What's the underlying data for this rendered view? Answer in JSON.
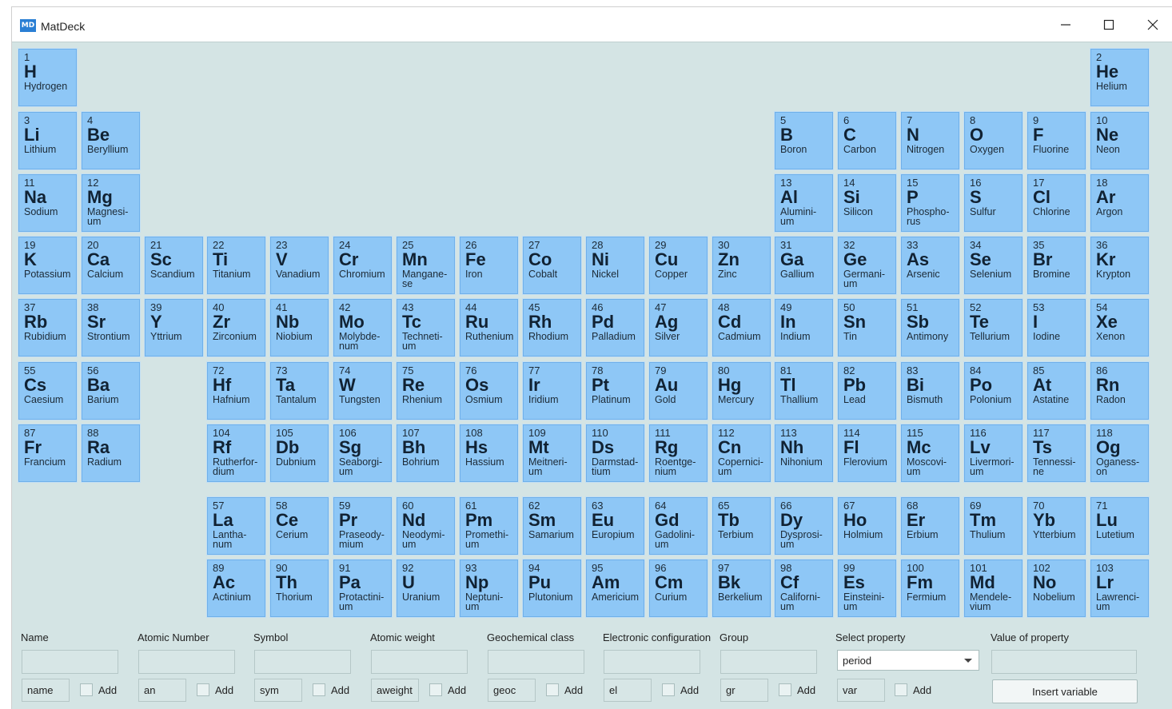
{
  "window": {
    "title": "MatDeck",
    "icon_text": "MD",
    "minimize_icon": "minimize-icon",
    "maximize_icon": "maximize-icon",
    "close_icon": "close-icon"
  },
  "elements": [
    {
      "n": "1",
      "s": "H",
      "name": "Hydrogen"
    },
    {
      "n": "2",
      "s": "He",
      "name": "Helium"
    },
    {
      "n": "3",
      "s": "Li",
      "name": "Lithium"
    },
    {
      "n": "4",
      "s": "Be",
      "name": "Beryllium"
    },
    {
      "n": "5",
      "s": "B",
      "name": "Boron"
    },
    {
      "n": "6",
      "s": "C",
      "name": "Carbon"
    },
    {
      "n": "7",
      "s": "N",
      "name": "Nitrogen"
    },
    {
      "n": "8",
      "s": "O",
      "name": "Oxygen"
    },
    {
      "n": "9",
      "s": "F",
      "name": "Fluorine"
    },
    {
      "n": "10",
      "s": "Ne",
      "name": "Neon"
    },
    {
      "n": "11",
      "s": "Na",
      "name": "Sodium"
    },
    {
      "n": "12",
      "s": "Mg",
      "name": "Magnesi-\num"
    },
    {
      "n": "13",
      "s": "Al",
      "name": "Alumini-\num"
    },
    {
      "n": "14",
      "s": "Si",
      "name": "Silicon"
    },
    {
      "n": "15",
      "s": "P",
      "name": "Phospho-\nrus"
    },
    {
      "n": "16",
      "s": "S",
      "name": "Sulfur"
    },
    {
      "n": "17",
      "s": "Cl",
      "name": "Chlorine"
    },
    {
      "n": "18",
      "s": "Ar",
      "name": "Argon"
    },
    {
      "n": "19",
      "s": "K",
      "name": "Potassium"
    },
    {
      "n": "20",
      "s": "Ca",
      "name": "Calcium"
    },
    {
      "n": "21",
      "s": "Sc",
      "name": "Scandium"
    },
    {
      "n": "22",
      "s": "Ti",
      "name": "Titanium"
    },
    {
      "n": "23",
      "s": "V",
      "name": "Vanadium"
    },
    {
      "n": "24",
      "s": "Cr",
      "name": "Chromium"
    },
    {
      "n": "25",
      "s": "Mn",
      "name": "Mangane-\nse"
    },
    {
      "n": "26",
      "s": "Fe",
      "name": "Iron"
    },
    {
      "n": "27",
      "s": "Co",
      "name": "Cobalt"
    },
    {
      "n": "28",
      "s": "Ni",
      "name": "Nickel"
    },
    {
      "n": "29",
      "s": "Cu",
      "name": "Copper"
    },
    {
      "n": "30",
      "s": "Zn",
      "name": "Zinc"
    },
    {
      "n": "31",
      "s": "Ga",
      "name": "Gallium"
    },
    {
      "n": "32",
      "s": "Ge",
      "name": "Germani-\num"
    },
    {
      "n": "33",
      "s": "As",
      "name": "Arsenic"
    },
    {
      "n": "34",
      "s": "Se",
      "name": "Selenium"
    },
    {
      "n": "35",
      "s": "Br",
      "name": "Bromine"
    },
    {
      "n": "36",
      "s": "Kr",
      "name": "Krypton"
    },
    {
      "n": "37",
      "s": "Rb",
      "name": "Rubidium"
    },
    {
      "n": "38",
      "s": "Sr",
      "name": "Strontium"
    },
    {
      "n": "39",
      "s": "Y",
      "name": "Yttrium"
    },
    {
      "n": "40",
      "s": "Zr",
      "name": "Zirconium"
    },
    {
      "n": "41",
      "s": "Nb",
      "name": "Niobium"
    },
    {
      "n": "42",
      "s": "Mo",
      "name": "Molybde-\nnum"
    },
    {
      "n": "43",
      "s": "Tc",
      "name": "Techneti-\num"
    },
    {
      "n": "44",
      "s": "Ru",
      "name": "Ruthenium"
    },
    {
      "n": "45",
      "s": "Rh",
      "name": "Rhodium"
    },
    {
      "n": "46",
      "s": "Pd",
      "name": "Palladium"
    },
    {
      "n": "47",
      "s": "Ag",
      "name": "Silver"
    },
    {
      "n": "48",
      "s": "Cd",
      "name": "Cadmium"
    },
    {
      "n": "49",
      "s": "In",
      "name": "Indium"
    },
    {
      "n": "50",
      "s": "Sn",
      "name": "Tin"
    },
    {
      "n": "51",
      "s": "Sb",
      "name": "Antimony"
    },
    {
      "n": "52",
      "s": "Te",
      "name": "Tellurium"
    },
    {
      "n": "53",
      "s": "I",
      "name": "Iodine"
    },
    {
      "n": "54",
      "s": "Xe",
      "name": "Xenon"
    },
    {
      "n": "55",
      "s": "Cs",
      "name": "Caesium"
    },
    {
      "n": "56",
      "s": "Ba",
      "name": "Barium"
    },
    {
      "n": "72",
      "s": "Hf",
      "name": "Hafnium"
    },
    {
      "n": "73",
      "s": "Ta",
      "name": "Tantalum"
    },
    {
      "n": "74",
      "s": "W",
      "name": "Tungsten"
    },
    {
      "n": "75",
      "s": "Re",
      "name": "Rhenium"
    },
    {
      "n": "76",
      "s": "Os",
      "name": "Osmium"
    },
    {
      "n": "77",
      "s": "Ir",
      "name": "Iridium"
    },
    {
      "n": "78",
      "s": "Pt",
      "name": "Platinum"
    },
    {
      "n": "79",
      "s": "Au",
      "name": "Gold"
    },
    {
      "n": "80",
      "s": "Hg",
      "name": "Mercury"
    },
    {
      "n": "81",
      "s": "Tl",
      "name": "Thallium"
    },
    {
      "n": "82",
      "s": "Pb",
      "name": "Lead"
    },
    {
      "n": "83",
      "s": "Bi",
      "name": "Bismuth"
    },
    {
      "n": "84",
      "s": "Po",
      "name": "Polonium"
    },
    {
      "n": "85",
      "s": "At",
      "name": "Astatine"
    },
    {
      "n": "86",
      "s": "Rn",
      "name": "Radon"
    },
    {
      "n": "87",
      "s": "Fr",
      "name": "Francium"
    },
    {
      "n": "88",
      "s": "Ra",
      "name": "Radium"
    },
    {
      "n": "104",
      "s": "Rf",
      "name": "Rutherfor-\ndium"
    },
    {
      "n": "105",
      "s": "Db",
      "name": "Dubnium"
    },
    {
      "n": "106",
      "s": "Sg",
      "name": "Seaborgi-\num"
    },
    {
      "n": "107",
      "s": "Bh",
      "name": "Bohrium"
    },
    {
      "n": "108",
      "s": "Hs",
      "name": "Hassium"
    },
    {
      "n": "109",
      "s": "Mt",
      "name": "Meitneri-\num"
    },
    {
      "n": "110",
      "s": "Ds",
      "name": "Darmstad-\ntium"
    },
    {
      "n": "111",
      "s": "Rg",
      "name": "Roentge-\nnium"
    },
    {
      "n": "112",
      "s": "Cn",
      "name": "Copernici-\num"
    },
    {
      "n": "113",
      "s": "Nh",
      "name": "Nihonium"
    },
    {
      "n": "114",
      "s": "Fl",
      "name": "Flerovium"
    },
    {
      "n": "115",
      "s": "Mc",
      "name": "Moscovi-\num"
    },
    {
      "n": "116",
      "s": "Lv",
      "name": "Livermori-\num"
    },
    {
      "n": "117",
      "s": "Ts",
      "name": "Tennessi-\nne"
    },
    {
      "n": "118",
      "s": "Og",
      "name": "Oganess-\non"
    },
    {
      "n": "57",
      "s": "La",
      "name": "Lantha-\nnum"
    },
    {
      "n": "58",
      "s": "Ce",
      "name": "Cerium"
    },
    {
      "n": "59",
      "s": "Pr",
      "name": "Praseody-\nmium"
    },
    {
      "n": "60",
      "s": "Nd",
      "name": "Neodymi-\num"
    },
    {
      "n": "61",
      "s": "Pm",
      "name": "Promethi-\num"
    },
    {
      "n": "62",
      "s": "Sm",
      "name": "Samarium"
    },
    {
      "n": "63",
      "s": "Eu",
      "name": "Europium"
    },
    {
      "n": "64",
      "s": "Gd",
      "name": "Gadolini-\num"
    },
    {
      "n": "65",
      "s": "Tb",
      "name": "Terbium"
    },
    {
      "n": "66",
      "s": "Dy",
      "name": "Dysprosi-\num"
    },
    {
      "n": "67",
      "s": "Ho",
      "name": "Holmium"
    },
    {
      "n": "68",
      "s": "Er",
      "name": "Erbium"
    },
    {
      "n": "69",
      "s": "Tm",
      "name": "Thulium"
    },
    {
      "n": "70",
      "s": "Yb",
      "name": "Ytterbium"
    },
    {
      "n": "71",
      "s": "Lu",
      "name": "Lutetium"
    },
    {
      "n": "89",
      "s": "Ac",
      "name": "Actinium"
    },
    {
      "n": "90",
      "s": "Th",
      "name": "Thorium"
    },
    {
      "n": "91",
      "s": "Pa",
      "name": "Protactini-\num"
    },
    {
      "n": "92",
      "s": "U",
      "name": "Uranium"
    },
    {
      "n": "93",
      "s": "Np",
      "name": "Neptuni-\num"
    },
    {
      "n": "94",
      "s": "Pu",
      "name": "Plutonium"
    },
    {
      "n": "95",
      "s": "Am",
      "name": "Americium"
    },
    {
      "n": "96",
      "s": "Cm",
      "name": "Curium"
    },
    {
      "n": "97",
      "s": "Bk",
      "name": "Berkelium"
    },
    {
      "n": "98",
      "s": "Cf",
      "name": "Californi-\num"
    },
    {
      "n": "99",
      "s": "Es",
      "name": "Einsteini-\num"
    },
    {
      "n": "100",
      "s": "Fm",
      "name": "Fermium"
    },
    {
      "n": "101",
      "s": "Md",
      "name": "Mendele-\nvium"
    },
    {
      "n": "102",
      "s": "No",
      "name": "Nobelium"
    },
    {
      "n": "103",
      "s": "Lr",
      "name": "Lawrenci-\num"
    }
  ],
  "form": {
    "fields": [
      {
        "label": "Name",
        "value": "",
        "var": "name",
        "add": "Add"
      },
      {
        "label": "Atomic Number",
        "value": "",
        "var": "an",
        "add": "Add"
      },
      {
        "label": "Symbol",
        "value": "",
        "var": "sym",
        "add": "Add"
      },
      {
        "label": "Atomic weight",
        "value": "",
        "var": "aweight",
        "add": "Add"
      },
      {
        "label": "Geochemical class",
        "value": "",
        "var": "geoc",
        "add": "Add"
      },
      {
        "label": "Electronic configuration",
        "value": "",
        "var": "el",
        "add": "Add"
      },
      {
        "label": "Group",
        "value": "",
        "var": "gr",
        "add": "Add"
      }
    ],
    "select_property": {
      "label": "Select property",
      "selected": "period",
      "var": "var",
      "add": "Add"
    },
    "value_of_property": {
      "label": "Value of property",
      "value": ""
    },
    "insert_button": "Insert variable"
  },
  "colors": {
    "element_fill": "#8ec7f6",
    "element_border": "#6fb0ea",
    "window_bg": "#d4e4e4",
    "accent_icon": "#2a7fd4"
  }
}
